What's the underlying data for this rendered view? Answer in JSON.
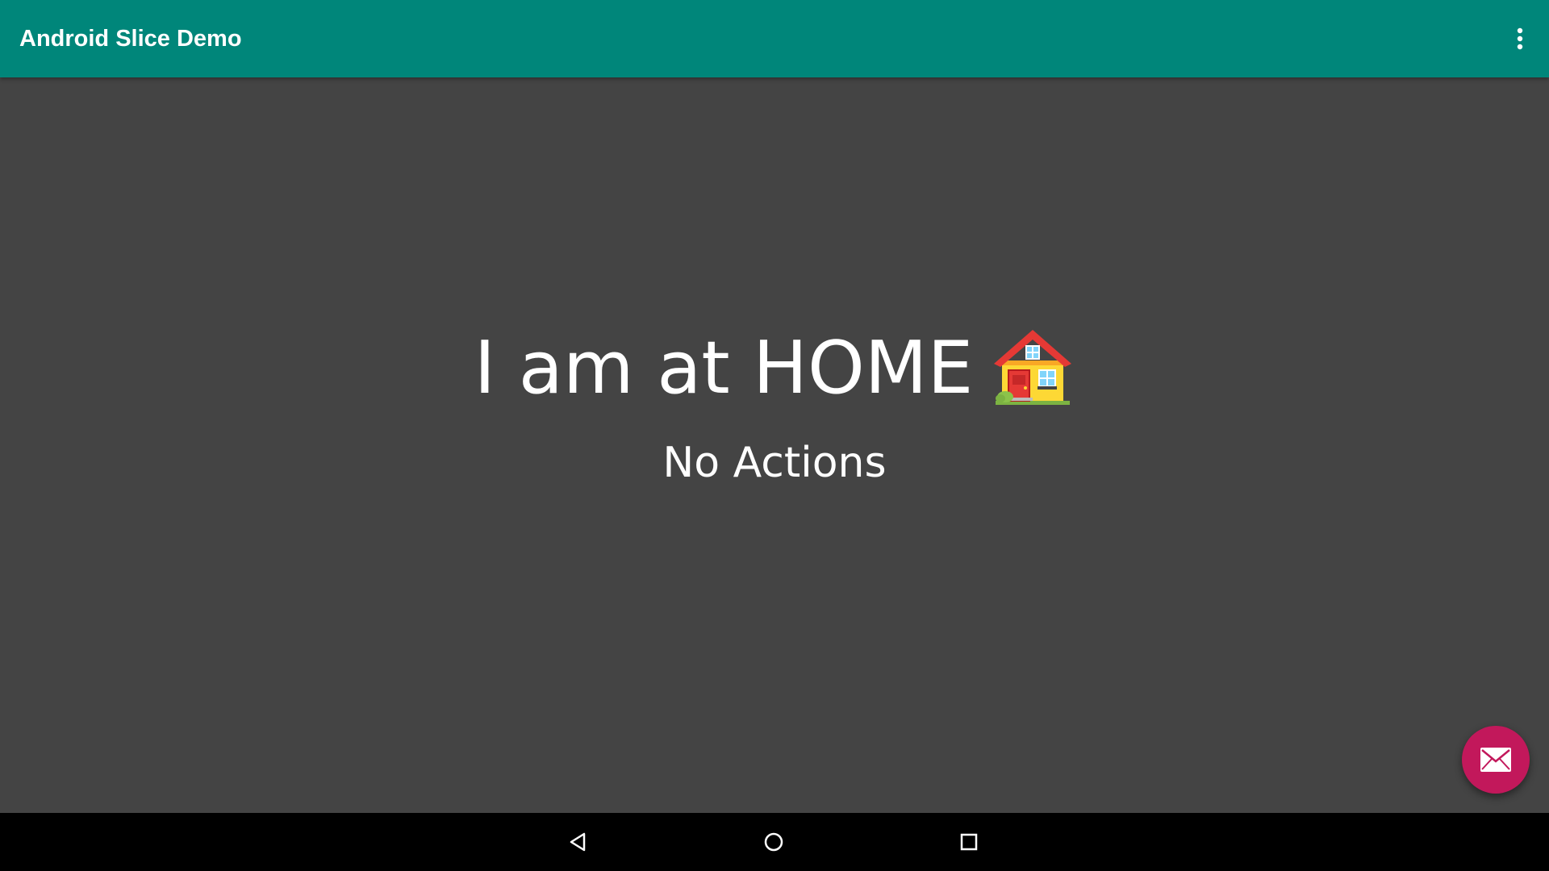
{
  "app_bar": {
    "title": "Android Slice Demo",
    "background_color": "#00867A",
    "overflow_icon": "more-vert-icon"
  },
  "main": {
    "headline": "I am at HOME",
    "headline_emoji_icon": "house-icon",
    "subtitle": "No Actions",
    "background_color": "#444444"
  },
  "fab": {
    "icon": "email-icon",
    "color": "#C2185B"
  },
  "nav_bar": {
    "buttons": [
      {
        "name": "back",
        "icon": "back-triangle-icon"
      },
      {
        "name": "home",
        "icon": "home-circle-icon"
      },
      {
        "name": "recents",
        "icon": "recents-square-icon"
      }
    ]
  }
}
